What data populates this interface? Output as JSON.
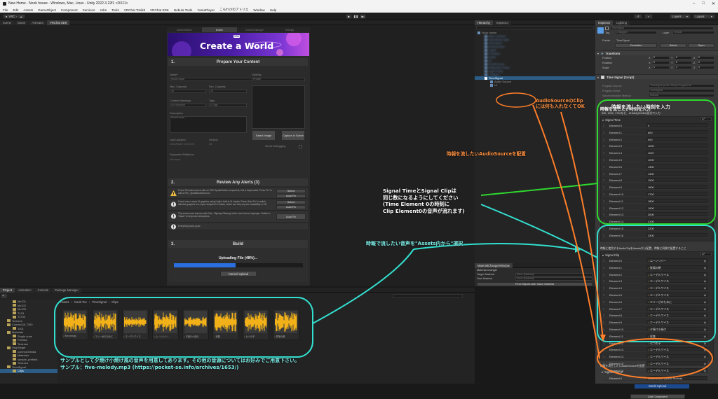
{
  "titlebar": {
    "title": "New Home - Nook house - Windows, Mac, Linux - Unity 2022.3.22f1 <DX11>"
  },
  "menu": [
    "File",
    "Edit",
    "Assets",
    "GameObject",
    "Component",
    "Services",
    "Jobs",
    "Tools",
    "VRChat Toolkit",
    "VRChat SDK",
    "Nebula Tools",
    "YamaPlayer",
    "こもれびのアトリエ",
    "Window",
    "Help"
  ],
  "toolbar": {
    "account": "VRC",
    "layers": "Layers",
    "layout": "Layout"
  },
  "scene_tabs": [
    "Scene",
    "Game",
    "Animator",
    "VRChat SDK"
  ],
  "sdk": {
    "tabs": [
      "Authentication",
      "Builder",
      "Content Manager",
      "Settings"
    ],
    "banner": {
      "badge": "VRC",
      "title": "Create a World"
    },
    "s1": {
      "num": "1.",
      "title": "Prepare Your Content",
      "name_label": "Name*",
      "name_value": "Nook house",
      "visibility_label": "Visibility",
      "visibility_value": "Private",
      "capacity_label": "Max. Capacity",
      "capacity_value": "16",
      "rec_label": "Rec. Capacity",
      "rec_value": "16",
      "warnings_label": "Content Warnings",
      "warnings_value": "0/5 Selected",
      "tags_label": "Tags",
      "tags_value": "0 Tags",
      "desc_label": "Description",
      "desc_placeholder": "Nook house",
      "updated_label": "Last Updated",
      "updated_value": "2024/05/22 14:00:00",
      "version_label": "Version",
      "version_value": "28",
      "platforms_label": "Supported Platforms",
      "platforms_value": "Windows",
      "select_image": "Select Image",
      "capture_image": "Capture In Scene",
      "debug_label": "World Debugging"
    },
    "s2": {
      "num": "2.",
      "title": "Review Any Alerts (3)",
      "alerts": [
        {
          "text": "Found 30 audio source with no VRC Spatial Audio component, this is deprecated. Press 'Fix' to add a VRC_SpatialAudioSource.",
          "buttons": [
            "Select",
            "Auto Fix"
          ]
        },
        {
          "text": "Found one or more UI graphics using Unity's built-in UI shader. Press 'Auto Fix' to switch affected graphics to a super-sampled UI shader, which can help improve readability in VR.",
          "buttons": [
            "Select",
            "Auto Fix"
          ]
        },
        {
          "text": "This scene uses textures with 'Gen. Mipmap Filtering' which have blurred mipmaps. Switch to 'Kaiser' for improved sharpness.",
          "buttons": [
            "Auto Fix"
          ]
        },
        {
          "text": "Everything looks good",
          "buttons": []
        }
      ]
    },
    "s3": {
      "num": "3.",
      "title": "Build",
      "status": "Uploading File (48%)...",
      "progress": 0.48,
      "cancel": "Cancel Upload"
    }
  },
  "hierarchy": {
    "tabs": [
      "Hierarchy",
      "Inspector"
    ],
    "rows": [
      "Nook house",
      "Main Camera",
      "Directional Light",
      "VRCWorld",
      "Environment",
      "Lights",
      "Furniture",
      "Audio",
      "UI",
      "PostProcess",
      "Reflection Probe",
      "Light Probe",
      "Colliders",
      "TimeSignal",
      "Audio Source",
      "UI"
    ],
    "selected": "TimeSignal"
  },
  "material_changer": {
    "title": "MaterialChangerWindow",
    "header": "Material Changer",
    "target_label": "Target Material",
    "target_value": "None (Material)",
    "new_label": "New Material",
    "new_value": "None (Material)",
    "find_button": "Find Objects with Same Material"
  },
  "inspector": {
    "tabs": [
      "Inspector",
      "Lighting"
    ],
    "object_name": "TimeSignal",
    "tag_label": "Tag",
    "tag_value": "Untagged",
    "layer_label": "Layer",
    "layer_value": "Default",
    "prefab_label": "Prefab",
    "prefab_name": "TimeSignal",
    "overrides": "Overrides",
    "select": "Select",
    "open": "Open",
    "transform": {
      "title": "Transform",
      "position_label": "Position",
      "rotation_label": "Rotation",
      "scale_label": "Scale",
      "position": [
        "0",
        "0",
        "0"
      ],
      "rotation": [
        "0",
        "0",
        "0"
      ],
      "scale": [
        "1",
        "1",
        "1"
      ]
    },
    "script": {
      "title": "Time Signal (Script)",
      "program_source_label": "Program Source",
      "program_source_value": "TimeSignal (Udon Sharp Program As",
      "program_script_label": "Program Script",
      "program_script_value": "TimeSignal",
      "sync_label": "Synchronization Method",
      "sync_value": "Manual"
    },
    "time_header": "時報を流したい時刻を入力",
    "time_hint": "900, 1200, 1700など、HHMM(HHMM)形式で入力",
    "signal_time": {
      "label": "Signal Time",
      "count": "17",
      "values": [
        "0",
        "600",
        "900",
        "1000",
        "1100",
        "1200",
        "1300",
        "1400",
        "1500",
        "1600",
        "1700",
        "1800",
        "1900",
        "2000",
        "2100",
        "2200",
        "2300"
      ]
    },
    "clip_header": "時報に使用するAudioClipをAssetsから配置、時報と同順で配置すること",
    "signal_clip": {
      "label": "Signal Clip",
      "count": "17",
      "values": [
        "ムーンリバー",
        "牧場の朝",
        "エーデルワイス",
        "エーデルワイス",
        "エーデルワイス",
        "エーデルワイス",
        "エリーゼのために",
        "エーデルワイス",
        "エーデルワイス",
        "エーデルワイス",
        "夕焼け小焼け",
        "家路",
        "七つの子",
        "エーデルワイス",
        "エーデルワイス",
        "エーデルワイス",
        "エーデルワイス"
      ]
    },
    "source_header": "時報を再生したいAudioSourceを配置",
    "signal_source": {
      "label": "Signal Source",
      "element": "Element 0",
      "value": "AudioSource (Audio Source)"
    },
    "add_component": "Add Component"
  },
  "project": {
    "tabs": [
      "Project",
      "Animation",
      "Console",
      "Package Manager"
    ],
    "breadcrumb": [
      "Assets",
      "Nook-Tox",
      "TimeSignal",
      "Clips"
    ],
    "tree": [
      "Mc101",
      "Mc102",
      "Mc103",
      "T103",
      "TLT03",
      "Textures",
      "Combo115-7300",
      "1401",
      "Materials",
      "Single cube",
      "Prefabs",
      "Textures",
      "StopTarget",
      "commonMedia",
      "Materials",
      "sample_prefabs",
      "Textures",
      "TimeSignal",
      "Clips"
    ],
    "clips": [
      "five-melody",
      "エリーゼのために",
      "エーデルワイス",
      "ムーンリバー",
      "夕焼け小焼け",
      "家路",
      "七つの子",
      "牧場の朝"
    ]
  },
  "annotations": {
    "a1": "時報を流したい時刻を入力",
    "a2": "AudioSourceのClip\nには何も入れなくてOK",
    "a3": "時報を流したいAudioSourceを配置",
    "a4": "Signal TimeとSignal Clipは\n同じ数になるようにしてください\n(Time Element 0の時刻に\nClip Element0の音声が流れます)",
    "a5": "時報で流したい音声を\"Assets内から\"選択",
    "a6": "サンプルとして夕焼け小焼け風の音声を用意してあります。その他の音源についてはお好みでご用意下さい。\nサンプル：five-melody.mp3 (https://pocket-se.info/archives/1653/)",
    "green": "#2fd82f",
    "cyan": "#33e0d0",
    "orange": "#ff7f2a"
  },
  "status": {
    "text": "World Upload"
  }
}
